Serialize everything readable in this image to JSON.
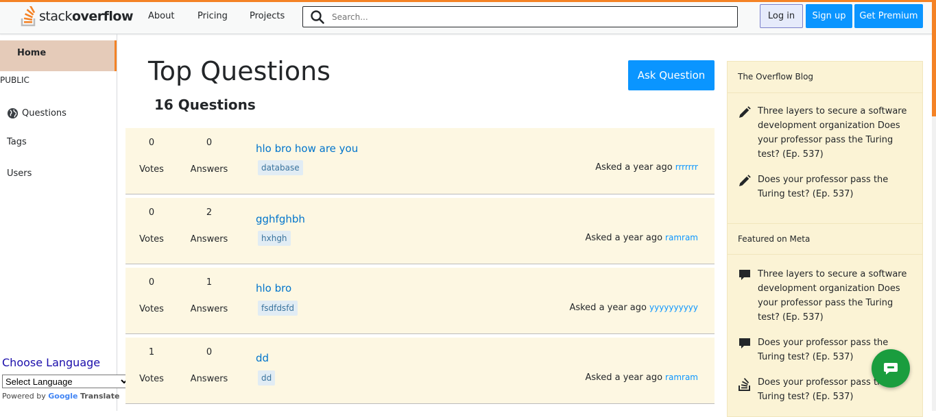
{
  "header": {
    "logo_light": "stack",
    "logo_bold": "overflow",
    "nav": [
      "About",
      "Pricing",
      "Projects"
    ],
    "search_placeholder": "Search...",
    "login": "Log in",
    "signup": "Sign up",
    "premium": "Get Premium"
  },
  "sidebar": {
    "home": "Home",
    "section": "PUBLIC",
    "items": [
      "Questions",
      "Tags",
      "Users"
    ],
    "language_title": "Choose Language",
    "language_select": "Select Language",
    "powered_by": "Powered by",
    "google": "Google",
    "translate": "Translate"
  },
  "main": {
    "title": "Top Questions",
    "count": "16 Questions",
    "ask_button": "Ask Question",
    "votes_label": "Votes",
    "answers_label": "Answers",
    "asked_label": "Asked a year ago",
    "questions": [
      {
        "votes": "0",
        "answers": "0",
        "title": "hlo bro how are you",
        "tag": "database",
        "user": "rrrrrrr"
      },
      {
        "votes": "0",
        "answers": "2",
        "title": "gghfghbh",
        "tag": "hxhgh",
        "user": "ramram"
      },
      {
        "votes": "0",
        "answers": "1",
        "title": "hlo bro",
        "tag": "fsdfdsfd",
        "user": "yyyyyyyyyy"
      },
      {
        "votes": "1",
        "answers": "0",
        "title": "dd",
        "tag": "dd",
        "user": "ramram"
      }
    ]
  },
  "widget": {
    "blog_title": "The Overflow Blog",
    "blog_items": [
      "Three layers to secure a software development organization Does your professor pass the Turing test? (Ep. 537)",
      "Does your professor pass the Turing test? (Ep. 537)"
    ],
    "meta_title": "Featured on Meta",
    "meta_items": [
      "Three layers to secure a software development organization Does your professor pass the Turing test? (Ep. 537)",
      "Does your professor pass the Turing test? (Ep. 537)",
      "Does your professor pass the Turing test? (Ep. 537)"
    ]
  },
  "colors": {
    "accent": "#f48225",
    "primary": "#0a95ff",
    "link": "#0074cc",
    "row_bg": "#fdf7e2",
    "widget_bg": "#fbf3d5",
    "chat": "#1a9d3e"
  },
  "icons": [
    "search-icon",
    "stackoverflow-logo-icon",
    "globe-icon",
    "pencil-icon",
    "comment-icon",
    "stackexchange-icon",
    "chat-icon"
  ]
}
